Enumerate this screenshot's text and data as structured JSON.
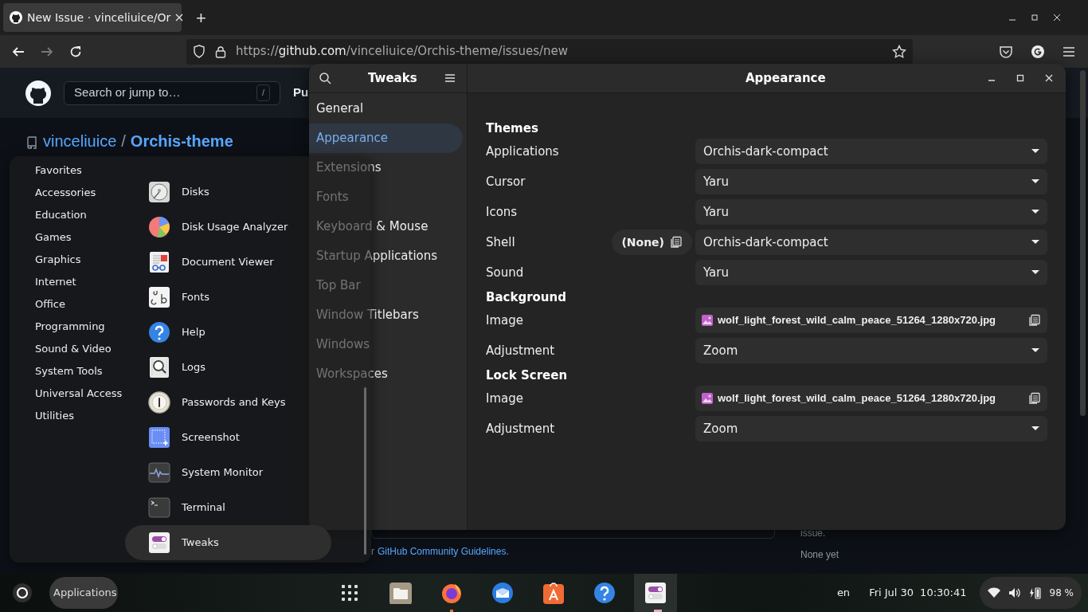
{
  "browser": {
    "tab": {
      "title": "New Issue · vinceliuice/Or",
      "selected": true
    },
    "new_tab": "+",
    "url": {
      "scheme": "https://",
      "host": "github.com",
      "path": "/vinceliuice/Orchis-theme/issues/new"
    }
  },
  "github": {
    "search_placeholder": "Search or jump to…",
    "search_key": "/",
    "nav_fragment": "Pu",
    "owner": "vinceliuice",
    "separator": "/",
    "repo": "Orchis-theme",
    "guidelines_prefix": "r",
    "guidelines_link": "GitHub Community Guidelines",
    "guidelines_suffix": ".",
    "sidebar_fragment": "issue.",
    "milestone": "None yet"
  },
  "tweaks": {
    "title": "Tweaks",
    "page_title": "Appearance",
    "sidebar": [
      {
        "label": "General",
        "selected": false
      },
      {
        "label": "Appearance",
        "selected": true
      },
      {
        "label": "Extensions",
        "selected": false
      },
      {
        "label": "Fonts",
        "selected": false
      },
      {
        "label": "Keyboard & Mouse",
        "selected": false
      },
      {
        "label": "Startup Applications",
        "selected": false
      },
      {
        "label": "Top Bar",
        "selected": false
      },
      {
        "label": "Window Titlebars",
        "selected": false
      },
      {
        "label": "Windows",
        "selected": false
      },
      {
        "label": "Workspaces",
        "selected": false
      }
    ],
    "sections": [
      {
        "title": "Themes",
        "rows": [
          {
            "label": "Applications",
            "kind": "dropdown",
            "value": "Orchis-dark-compact"
          },
          {
            "label": "Cursor",
            "kind": "dropdown",
            "value": "Yaru"
          },
          {
            "label": "Icons",
            "kind": "dropdown",
            "value": "Yaru"
          },
          {
            "label": "Shell",
            "kind": "dropdown",
            "value": "Orchis-dark-compact",
            "extra": "(None)"
          },
          {
            "label": "Sound",
            "kind": "dropdown",
            "value": "Yaru"
          }
        ]
      },
      {
        "title": "Background",
        "rows": [
          {
            "label": "Image",
            "kind": "file",
            "value": "wolf_light_forest_wild_calm_peace_51264_1280x720.jpg"
          },
          {
            "label": "Adjustment",
            "kind": "dropdown",
            "value": "Zoom"
          }
        ]
      },
      {
        "title": "Lock Screen",
        "rows": [
          {
            "label": "Image",
            "kind": "file",
            "value": "wolf_light_forest_wild_calm_peace_51264_1280x720.jpg"
          },
          {
            "label": "Adjustment",
            "kind": "dropdown",
            "value": "Zoom"
          }
        ]
      }
    ]
  },
  "app_menu": {
    "categories": [
      "Favorites",
      "Accessories",
      "Education",
      "Games",
      "Graphics",
      "Internet",
      "Office",
      "Programming",
      "Sound & Video",
      "System Tools",
      "Universal Access",
      "Utilities"
    ],
    "apps": [
      {
        "name": "Disks",
        "kind": "disks",
        "selected": false
      },
      {
        "name": "Disk Usage Analyzer",
        "kind": "pie",
        "selected": false
      },
      {
        "name": "Document Viewer",
        "kind": "document",
        "selected": false
      },
      {
        "name": "Fonts",
        "kind": "fonts",
        "selected": false
      },
      {
        "name": "Help",
        "kind": "help",
        "selected": false
      },
      {
        "name": "Logs",
        "kind": "logs",
        "selected": false
      },
      {
        "name": "Passwords and Keys",
        "kind": "passwords",
        "selected": false
      },
      {
        "name": "Screenshot",
        "kind": "screenshot",
        "selected": false
      },
      {
        "name": "System Monitor",
        "kind": "monitor",
        "selected": false
      },
      {
        "name": "Terminal",
        "kind": "terminal",
        "selected": false
      },
      {
        "name": "Tweaks",
        "kind": "tweaks",
        "selected": true
      }
    ]
  },
  "taskbar": {
    "apps_button": "Applications",
    "dock": [
      {
        "kind": "grid",
        "running": false
      },
      {
        "kind": "files",
        "running": false
      },
      {
        "kind": "firefox",
        "running": true
      },
      {
        "kind": "mail",
        "running": false
      },
      {
        "kind": "store",
        "running": false
      },
      {
        "kind": "help",
        "running": false
      },
      {
        "kind": "tweaks",
        "running": true
      }
    ],
    "keyboard": "en",
    "date": "Fri Jul 30",
    "time": "10:30:41",
    "battery": "98 %"
  }
}
